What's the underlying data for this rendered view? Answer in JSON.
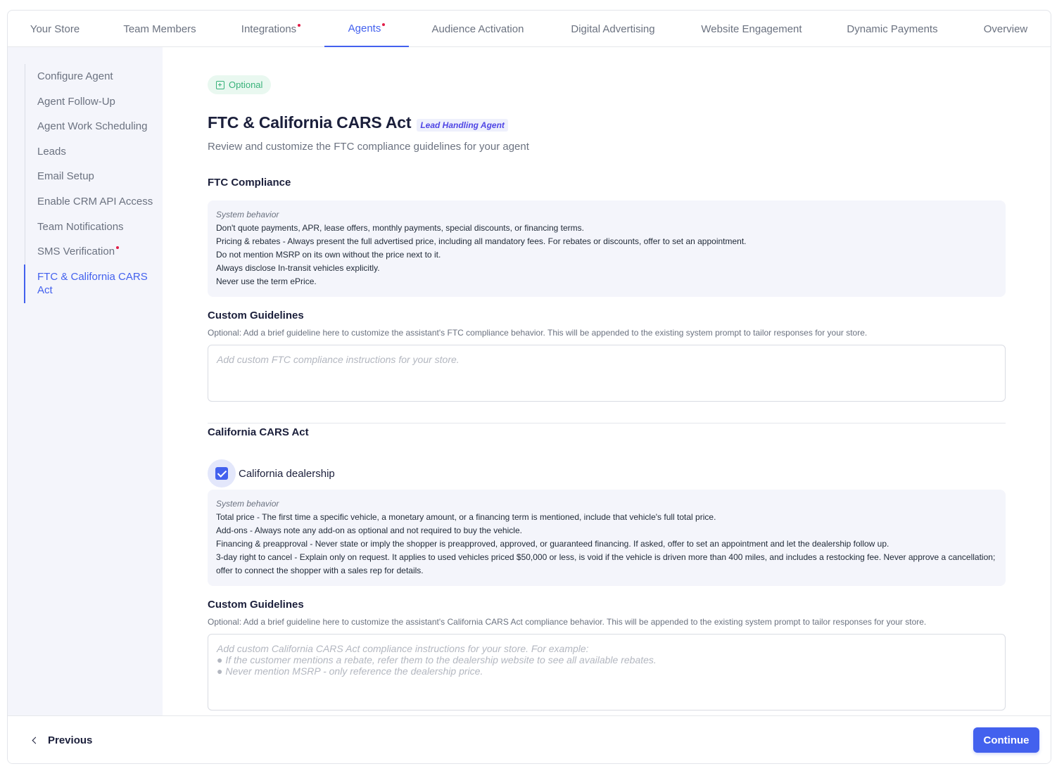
{
  "tabs": [
    {
      "label": "Your Store",
      "dot": false
    },
    {
      "label": "Team Members",
      "dot": false
    },
    {
      "label": "Integrations",
      "dot": true
    },
    {
      "label": "Agents",
      "dot": true,
      "active": true
    },
    {
      "label": "Audience Activation",
      "dot": false
    },
    {
      "label": "Digital Advertising",
      "dot": false
    },
    {
      "label": "Website Engagement",
      "dot": false
    },
    {
      "label": "Dynamic Payments",
      "dot": false
    },
    {
      "label": "Overview",
      "dot": false
    }
  ],
  "sidebar": {
    "items": [
      {
        "label": "Configure Agent"
      },
      {
        "label": "Agent Follow-Up"
      },
      {
        "label": "Agent Work Scheduling"
      },
      {
        "label": "Leads"
      },
      {
        "label": "Email Setup"
      },
      {
        "label": "Enable CRM API Access"
      },
      {
        "label": "Team Notifications"
      },
      {
        "label": "SMS Verification",
        "dot": true
      },
      {
        "label": "FTC & California CARS Act",
        "active": true
      }
    ]
  },
  "main": {
    "badge": "Optional",
    "title": "FTC & California CARS Act",
    "agent_tag": "Lead Handling Agent",
    "subtitle": "Review and customize the FTC compliance guidelines for your agent",
    "ftc": {
      "heading": "FTC Compliance",
      "system_label": "System behavior",
      "lines": [
        "Don't quote payments, APR, lease offers, monthly payments, special discounts, or financing terms.",
        "Pricing & rebates - Always present the full advertised price, including all mandatory fees. For rebates or discounts, offer to set an appointment.",
        "Do not mention MSRP on its own without the price next to it.",
        "Always disclose In-transit vehicles explicitly.",
        "Never use the term ePrice."
      ],
      "custom_heading": "Custom Guidelines",
      "custom_hint": "Optional: Add a brief guideline here to customize the assistant's FTC compliance behavior. This will be appended to the existing system prompt to tailor responses for your store.",
      "placeholder": "Add custom FTC compliance instructions for your store."
    },
    "cars": {
      "heading": "California CARS Act",
      "checkbox_label": "California dealership",
      "system_label": "System behavior",
      "lines": [
        "Total price - The first time a specific vehicle, a monetary amount, or a financing term is mentioned, include that vehicle's full total price.",
        "Add-ons - Always note any add-on as optional and not required to buy the vehicle.",
        "Financing & preapproval - Never state or imply the shopper is preapproved, approved, or guaranteed financing. If asked, offer to set an appointment and let the dealership follow up.",
        "3-day right to cancel - Explain only on request. It applies to used vehicles priced $50,000 or less, is void if the vehicle is driven more than 400 miles, and includes a restocking fee. Never approve a cancellation; offer to connect the shopper with a sales rep for details."
      ],
      "custom_heading": "Custom Guidelines",
      "custom_hint": "Optional: Add a brief guideline here to customize the assistant's California CARS Act compliance behavior. This will be appended to the existing system prompt to tailor responses for your store.",
      "placeholder": "Add custom California CARS Act compliance instructions for your store. For example:\n● If the customer mentions a rebate, refer them to the dealership website to see all available rebates.\n● Never mention MSRP - only reference the dealership price."
    }
  },
  "footer": {
    "previous_label": "Previous",
    "continue_label": "Continue"
  },
  "colors": {
    "accent": "#4361ee",
    "alert_dot": "#e11d48",
    "optional_badge": "#38b27a"
  }
}
